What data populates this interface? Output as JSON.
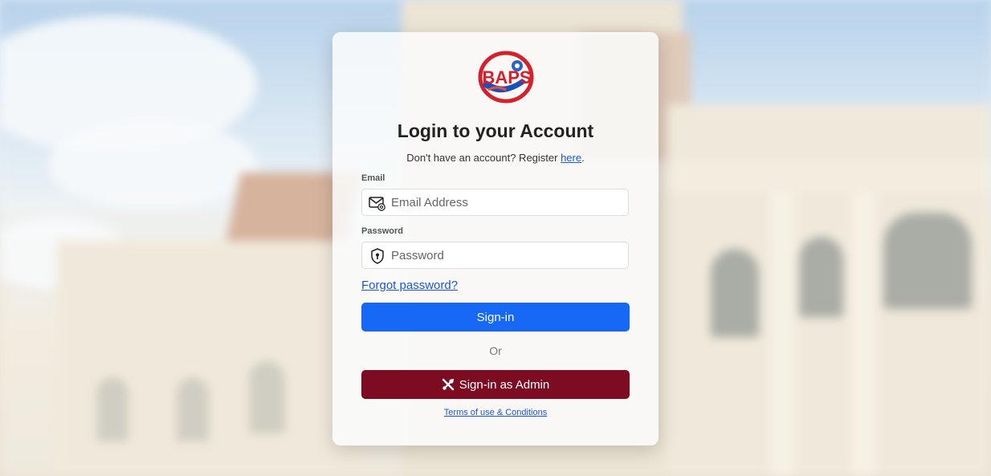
{
  "logo": {
    "text": "BAPS"
  },
  "title": "Login to your Account",
  "register": {
    "prefix": "Don't have an account? Register ",
    "link": "here",
    "suffix": "."
  },
  "email": {
    "label": "Email",
    "placeholder": "Email Address",
    "icon": "envelope-at-icon"
  },
  "password": {
    "label": "Password",
    "placeholder": "Password",
    "icon": "shield-lock-icon"
  },
  "forgot_password": "Forgot password?",
  "sign_in": "Sign-in",
  "or": "Or",
  "admin_sign_in": {
    "label": "Sign-in as Admin",
    "icon": "tools-icon"
  },
  "terms": "Terms of use & Conditions",
  "colors": {
    "primary": "#1668f5",
    "admin": "#7d0c22",
    "link": "#1a55e3"
  }
}
